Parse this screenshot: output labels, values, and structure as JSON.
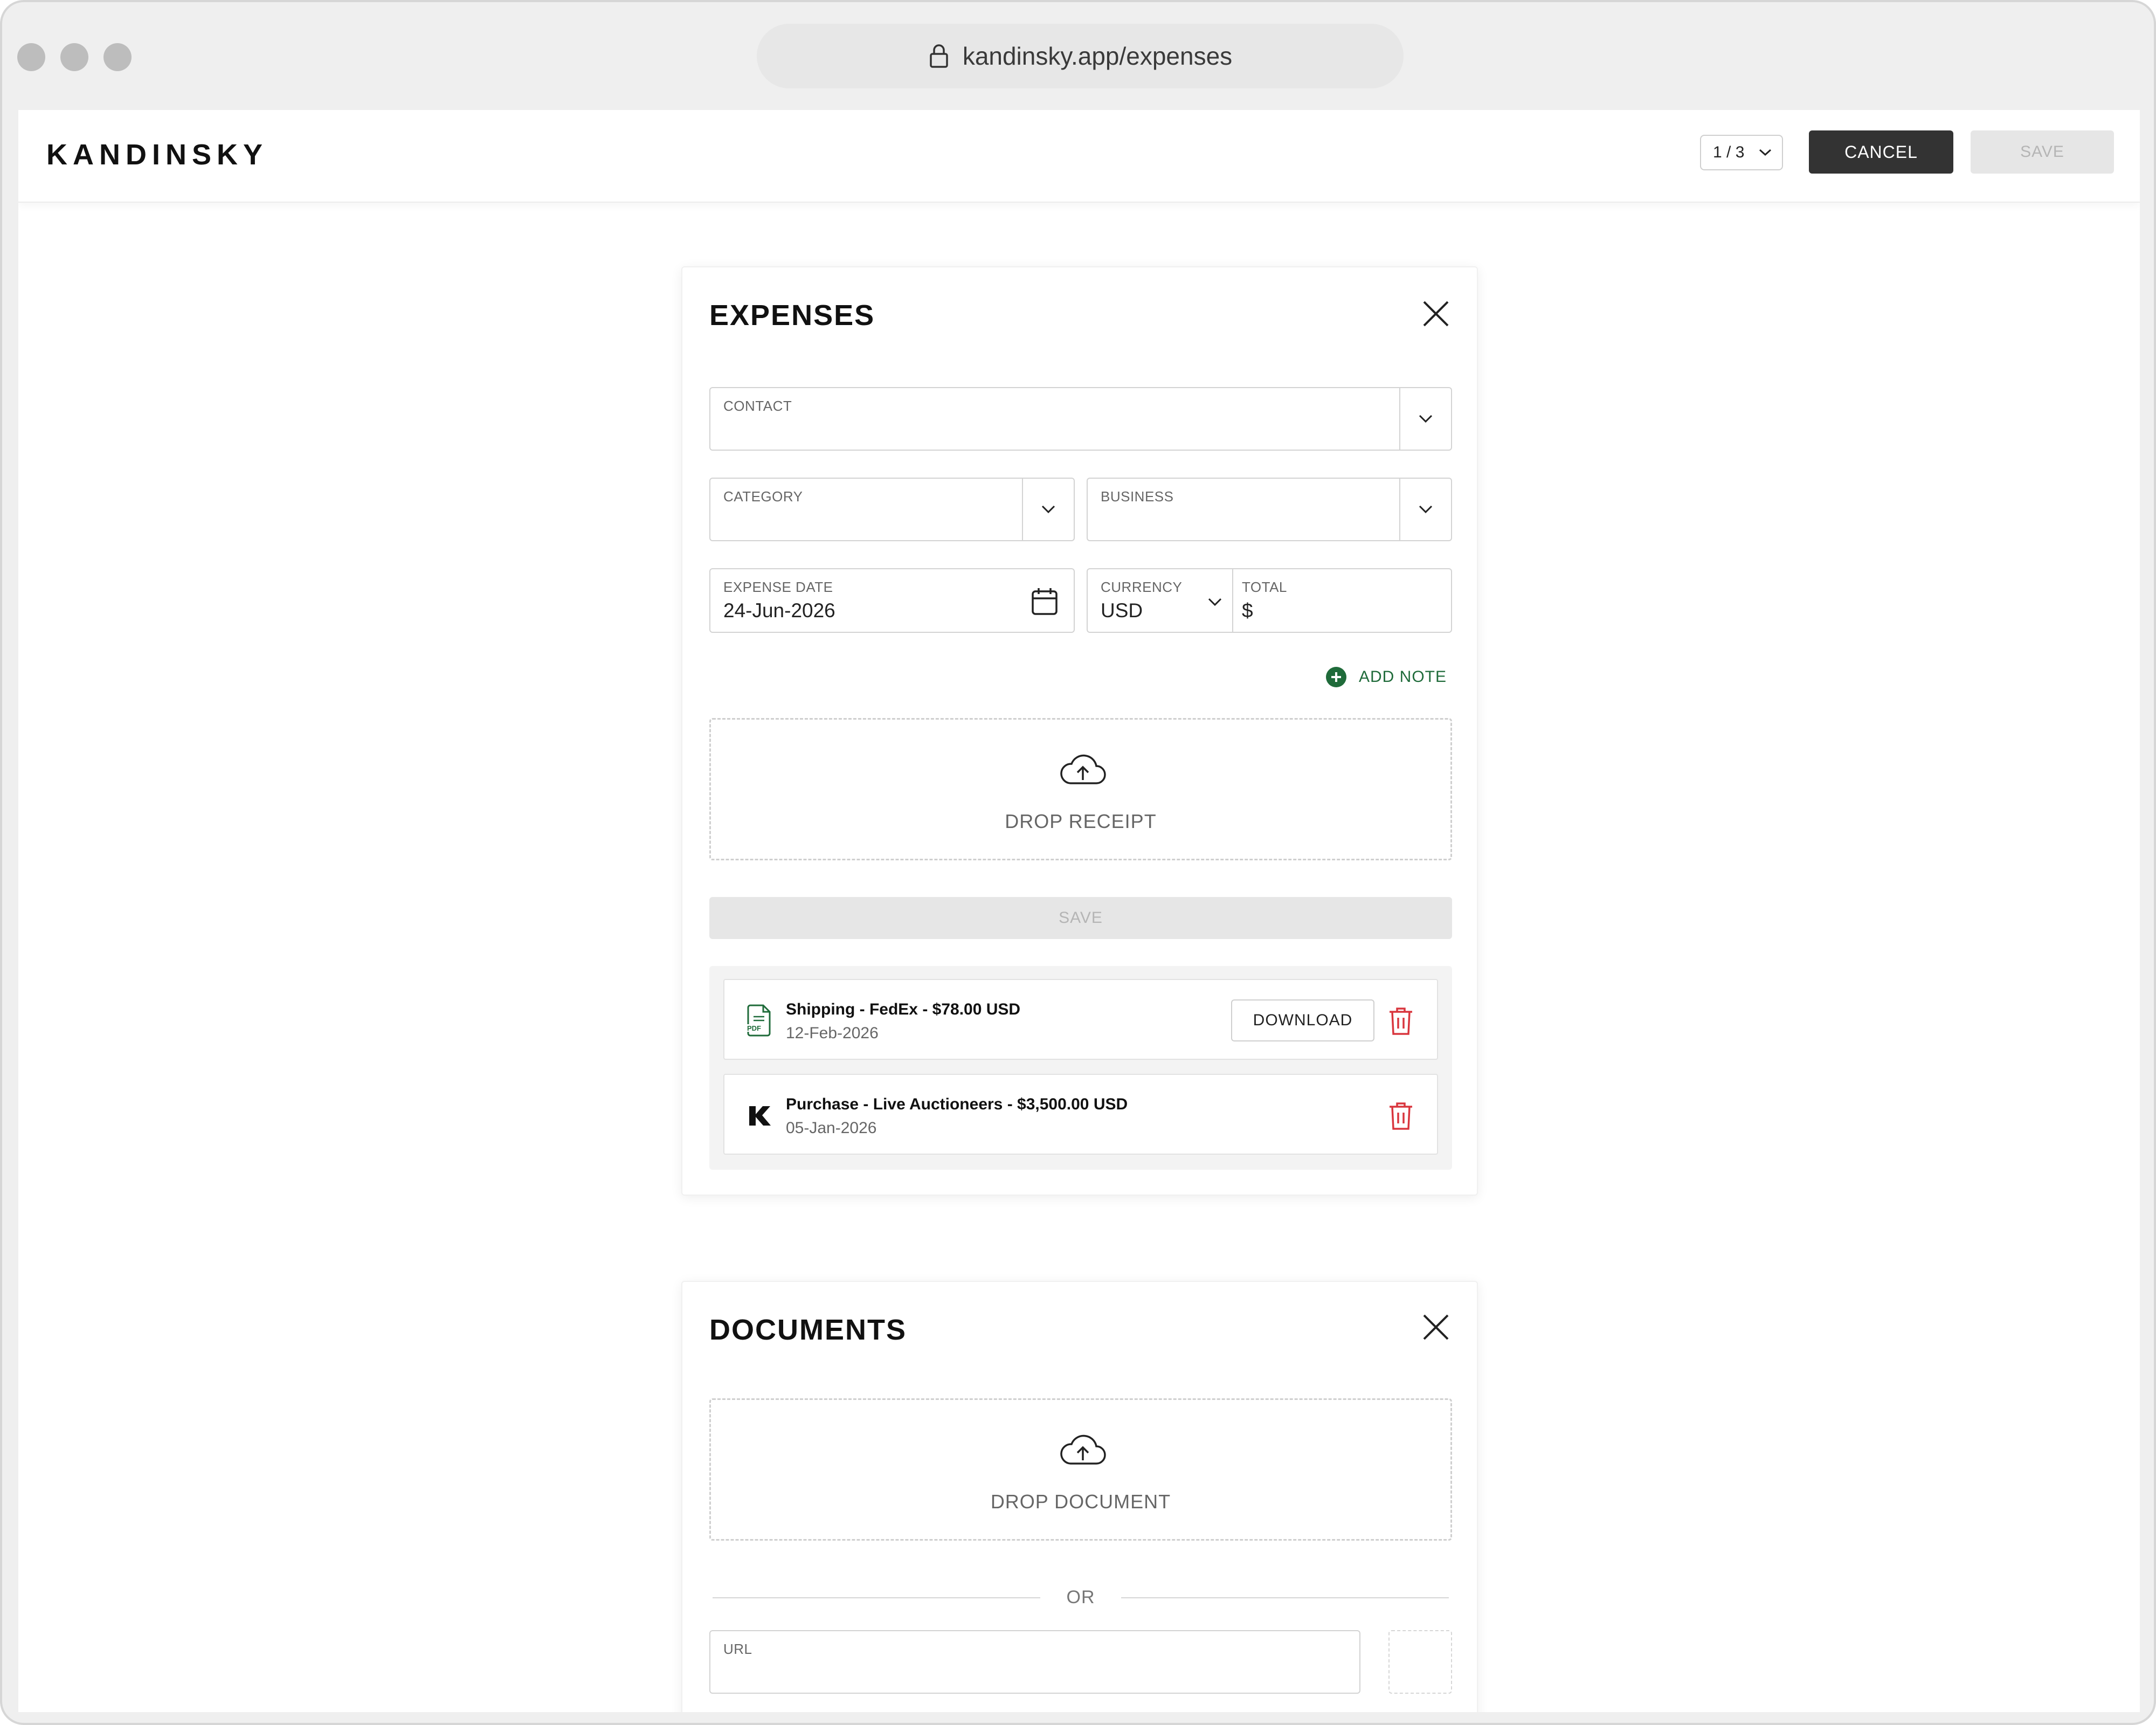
{
  "browser": {
    "url": "kandinsky.app/expenses",
    "dots_color": "#bdbdbd"
  },
  "app": {
    "logo": "KANDINSKY",
    "pager": {
      "value": "1 / 3"
    },
    "cancel_label": "CANCEL",
    "save_label": "SAVE",
    "accent_dark": "#333333",
    "accent_green": "#1f6b3a",
    "danger_red": "#d9363e"
  },
  "expenses": {
    "title": "EXPENSES",
    "contact": {
      "label": "CONTACT",
      "value": ""
    },
    "category": {
      "label": "CATEGORY",
      "value": ""
    },
    "business": {
      "label": "BUSINESS",
      "value": ""
    },
    "expense_date": {
      "label": "EXPENSE DATE",
      "value": "24-Jun-2026"
    },
    "currency": {
      "label": "CURRENCY",
      "value": "USD"
    },
    "total": {
      "label": "TOTAL",
      "value": "$"
    },
    "add_note_label": "ADD NOTE",
    "drop_receipt_label": "DROP RECEIPT",
    "save_label": "SAVE",
    "items": [
      {
        "title": "Shipping - FedEx - $78.00 USD",
        "date": "12-Feb-2026",
        "icon": "pdf-file-icon",
        "download_label": "DOWNLOAD"
      },
      {
        "title": "Purchase - Live Auctioneers - $3,500.00 USD",
        "date": "05-Jan-2026",
        "icon": "kandinsky-k-icon"
      }
    ]
  },
  "documents": {
    "title": "DOCUMENTS",
    "drop_document_label": "DROP DOCUMENT",
    "or_label": "OR",
    "url": {
      "label": "URL",
      "value": ""
    }
  }
}
